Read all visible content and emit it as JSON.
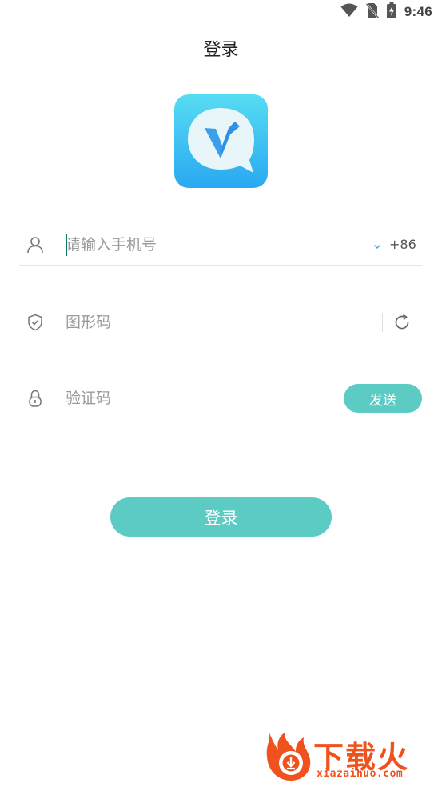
{
  "status_bar": {
    "time": "9:46",
    "icons": [
      "wifi-icon",
      "no-sim-icon",
      "battery-charging-icon"
    ]
  },
  "header": {
    "title": "登录"
  },
  "app_logo": {
    "icon": "bird-v-logo",
    "colors": {
      "gradient_top": "#4fd6f2",
      "gradient_bottom": "#2aa9f0",
      "mark": "#2f8de4"
    }
  },
  "form": {
    "phone": {
      "icon": "user-icon",
      "placeholder": "请输入手机号",
      "value": "",
      "country_code": "+86",
      "country_chevron_icon": "chevron-down-icon"
    },
    "captcha": {
      "icon": "shield-check-icon",
      "placeholder": "图形码",
      "value": "",
      "refresh_icon": "refresh-icon"
    },
    "verification_code": {
      "icon": "lock-icon",
      "placeholder": "验证码",
      "value": "",
      "send_label": "发送"
    },
    "login_label": "登录"
  },
  "watermark": {
    "text": "下载火",
    "url": "xiazaihuo.com"
  },
  "colors": {
    "accent": "#5ccbc3",
    "caret": "#0f7a6d",
    "watermark": "#f0521e"
  }
}
